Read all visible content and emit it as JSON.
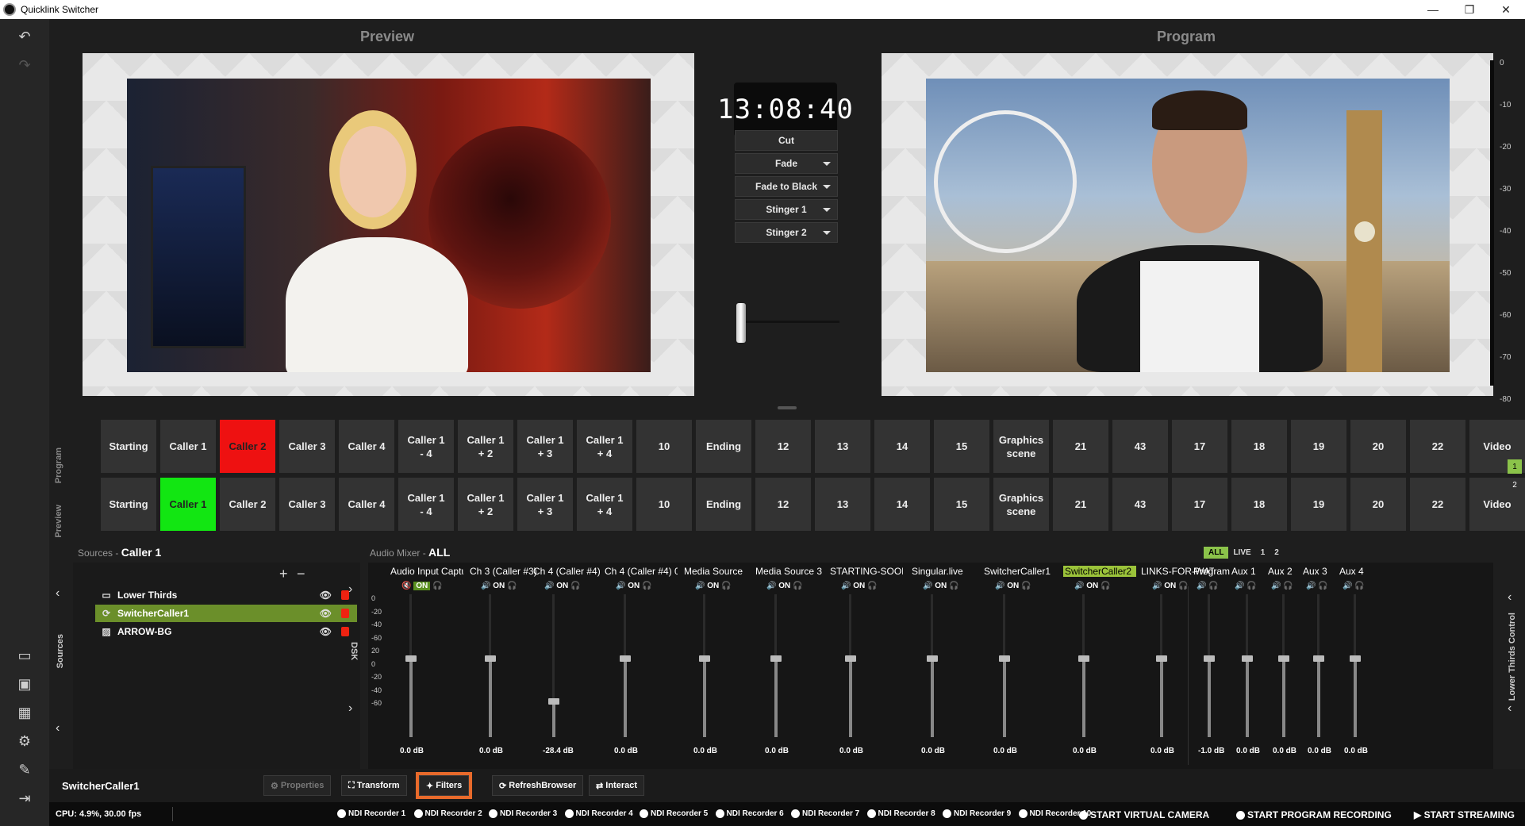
{
  "window": {
    "title": "Quicklink Switcher"
  },
  "panels": {
    "preview_title": "Preview",
    "program_title": "Program"
  },
  "clock": "13:08:40",
  "transitions": [
    {
      "label": "Cut",
      "dropdown": false
    },
    {
      "label": "Fade",
      "dropdown": true
    },
    {
      "label": "Fade to Black",
      "dropdown": true
    },
    {
      "label": "Stinger 1",
      "dropdown": true
    },
    {
      "label": "Stinger 2",
      "dropdown": true
    }
  ],
  "vu_scale": [
    "0",
    "-10",
    "-20",
    "-30",
    "-40",
    "-50",
    "-60",
    "-70",
    "-80"
  ],
  "scene_rows": {
    "program_label": "Program",
    "preview_label": "Preview",
    "program_active": "Caller 2",
    "preview_active": "Caller 1",
    "program": [
      "Starting",
      "Caller 1",
      "Caller 2",
      "Caller 3",
      "Caller 4",
      "Caller 1\n- 4",
      "Caller 1\n+ 2",
      "Caller 1\n+ 3",
      "Caller 1\n+ 4",
      "10",
      "Ending",
      "12",
      "13",
      "14",
      "15",
      "Graphics\nscene",
      "21",
      "43",
      "17",
      "18",
      "19",
      "20",
      "22",
      "Video"
    ],
    "preview": [
      "Starting",
      "Caller 1",
      "Caller 2",
      "Caller 3",
      "Caller 4",
      "Caller 1\n- 4",
      "Caller 1\n+ 2",
      "Caller 1\n+ 3",
      "Caller 1\n+ 4",
      "10",
      "Ending",
      "12",
      "13",
      "14",
      "15",
      "Graphics\nscene",
      "21",
      "43",
      "17",
      "18",
      "19",
      "20",
      "22",
      "Video"
    ]
  },
  "pages": [
    "1",
    "2"
  ],
  "sources": {
    "header": "Sources",
    "scene": "Caller 1",
    "side_label": "Sources",
    "items": [
      {
        "name": "Lower Thirds",
        "icon": "text-icon",
        "selected": false
      },
      {
        "name": "SwitcherCaller1",
        "icon": "refresh-icon",
        "selected": true
      },
      {
        "name": "ARROW-BG",
        "icon": "image-icon",
        "selected": false
      }
    ]
  },
  "dsk_label": "DSK",
  "mixer": {
    "header": "Audio Mixer",
    "filter": "ALL",
    "tabs": [
      "ALL",
      "LIVE",
      "1",
      "2"
    ],
    "scale": [
      "0",
      "-20",
      "-40",
      "-60",
      "20",
      "0",
      "-20",
      "-40",
      "-60"
    ],
    "channels": [
      {
        "name": "Audio Input Captur",
        "on": "ON",
        "muted": true,
        "db": "0.0 dB",
        "level": 0.55
      },
      {
        "name": "Ch 3 (Caller #3)",
        "on": "ON",
        "muted": false,
        "db": "0.0 dB",
        "level": 0.55
      },
      {
        "name": "Ch 4 (Caller #4)",
        "on": "ON",
        "muted": false,
        "db": "-28.4 dB",
        "level": 0.25
      },
      {
        "name": "Ch 4 (Caller #4) 0",
        "on": "ON",
        "muted": false,
        "db": "0.0 dB",
        "level": 0.55
      },
      {
        "name": "Media Source",
        "on": "ON",
        "muted": false,
        "db": "0.0 dB",
        "level": 0.55
      },
      {
        "name": "Media Source 3",
        "on": "ON",
        "muted": false,
        "db": "0.0 dB",
        "level": 0.55
      },
      {
        "name": "STARTING-SOON",
        "on": "ON",
        "muted": false,
        "db": "0.0 dB",
        "level": 0.55
      },
      {
        "name": "Singular.live",
        "on": "ON",
        "muted": false,
        "db": "0.0 dB",
        "level": 0.55
      },
      {
        "name": "SwitcherCaller1",
        "on": "ON",
        "muted": false,
        "db": "0.0 dB",
        "level": 0.55
      },
      {
        "name": "SwitcherCaller2",
        "on": "ON",
        "muted": false,
        "db": "0.0 dB",
        "level": 0.55,
        "highlight": true
      },
      {
        "name": "LINKS-FOR-WATCH",
        "on": "ON",
        "muted": false,
        "db": "0.0 dB",
        "level": 0.55
      }
    ],
    "outputs": [
      {
        "name": "Program",
        "db": "-1.0 dB",
        "level": 0.55
      },
      {
        "name": "Aux 1",
        "db": "0.0 dB",
        "level": 0.55
      },
      {
        "name": "Aux 2",
        "db": "0.0 dB",
        "level": 0.55
      },
      {
        "name": "Aux 3",
        "db": "0.0 dB",
        "level": 0.55
      },
      {
        "name": "Aux 4",
        "db": "0.0 dB",
        "level": 0.55
      }
    ]
  },
  "lower_thirds_label": "Lower Thirds Control",
  "toolbar": {
    "selected_source": "SwitcherCaller1",
    "properties": "Properties",
    "transform": "Transform",
    "filters": "Filters",
    "refresh": "RefreshBrowser",
    "interact": "Interact"
  },
  "status": {
    "cpu": "CPU: 4.9%, 30.00 fps",
    "recorders": [
      "NDI Recorder 1",
      "NDI Recorder 2",
      "NDI Recorder 3",
      "NDI Recorder 4",
      "NDI Recorder 5",
      "NDI Recorder 6",
      "NDI Recorder 7",
      "NDI Recorder 8",
      "NDI Recorder 9",
      "NDI Recorder 10"
    ],
    "virtual_camera": "START VIRTUAL CAMERA",
    "program_recording": "START PROGRAM RECORDING",
    "streaming": "START STREAMING"
  },
  "colors": {
    "program_active": "#ee1111",
    "preview_active": "#12e612",
    "selected_source": "#6b8f2a",
    "highlight": "#e86a2b"
  }
}
